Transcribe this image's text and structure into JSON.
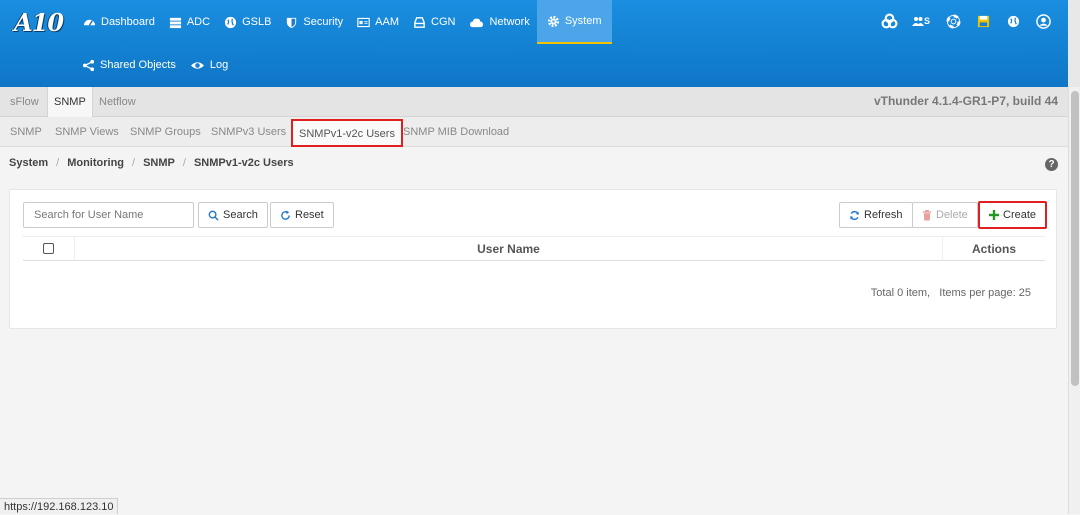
{
  "header": {
    "logo": "A10",
    "nav": [
      {
        "label": "Dashboard",
        "icon": "dashboard-icon"
      },
      {
        "label": "ADC",
        "icon": "server-icon"
      },
      {
        "label": "GSLB",
        "icon": "globe-icon"
      },
      {
        "label": "Security",
        "icon": "shield-icon"
      },
      {
        "label": "AAM",
        "icon": "id-card-icon"
      },
      {
        "label": "CGN",
        "icon": "router-icon"
      },
      {
        "label": "Network",
        "icon": "cloud-icon"
      },
      {
        "label": "System",
        "icon": "gear-icon",
        "active": true
      }
    ],
    "subnav": [
      {
        "label": "Shared Objects",
        "icon": "share-icon"
      },
      {
        "label": "Log",
        "icon": "eye-icon"
      }
    ],
    "tools": [
      {
        "icon": "cogs-icon"
      },
      {
        "icon": "users-icon",
        "label": "S"
      },
      {
        "icon": "lifebuoy-icon"
      },
      {
        "icon": "save-icon"
      },
      {
        "icon": "globe-icon"
      },
      {
        "icon": "user-icon"
      }
    ]
  },
  "tabs_primary": [
    {
      "label": "sFlow"
    },
    {
      "label": "SNMP",
      "active": true
    },
    {
      "label": "Netflow"
    }
  ],
  "version": "vThunder 4.1.4-GR1-P7, build 44",
  "tabs_secondary": [
    {
      "label": "SNMP"
    },
    {
      "label": "SNMP Views"
    },
    {
      "label": "SNMP Groups"
    },
    {
      "label": "SNMPv3 Users"
    },
    {
      "label": "SNMPv1-v2c Users",
      "active": true
    },
    {
      "label": "SNMP MIB Download"
    }
  ],
  "breadcrumb": [
    "System",
    "Monitoring",
    "SNMP",
    "SNMPv1-v2c Users"
  ],
  "breadcrumb_sep": "/",
  "help_glyph": "?",
  "toolbar": {
    "search_placeholder": "Search for User Name",
    "search_value": "",
    "search_label": "Search",
    "reset_label": "Reset",
    "refresh_label": "Refresh",
    "delete_label": "Delete",
    "create_label": "Create"
  },
  "table": {
    "columns": [
      "User Name",
      "Actions"
    ],
    "rows": []
  },
  "pager": {
    "summary": "Total 0 item,",
    "per_page": "Items per page: 25"
  },
  "status_url": "https://192.168.123.10",
  "colors": {
    "header_blue": "#1a8ee0",
    "active_underline": "#f2c400",
    "highlight_red": "#e02020",
    "create_green": "#1e9a1e",
    "delete_red": "#d9534f",
    "link_blue": "#1f77c9"
  }
}
